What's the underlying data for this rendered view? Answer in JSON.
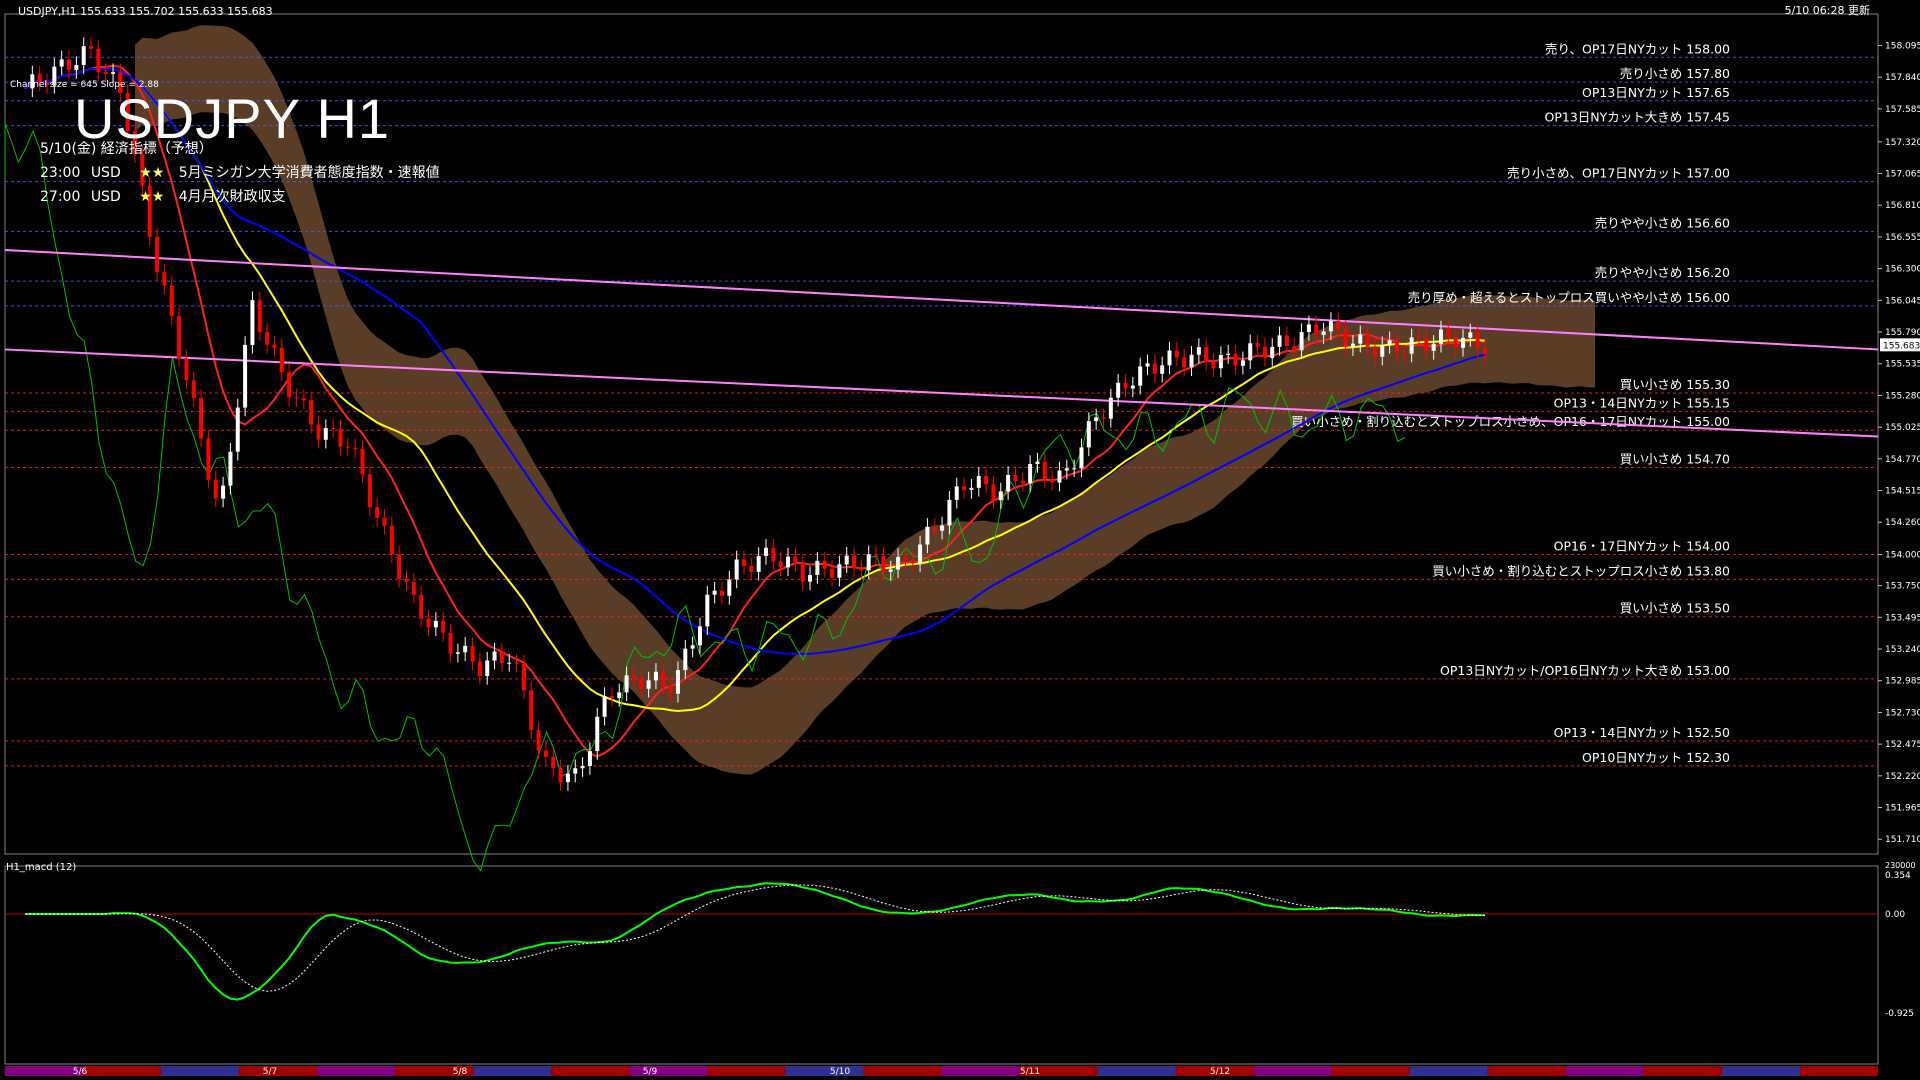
{
  "header": {
    "symbol_info": "USDJPY,H1  155.633 155.702 155.633 155.683",
    "updated": "5/10 06:28 更新"
  },
  "title": "USDJPY H1",
  "indicator_note": "Channel size = 645 Slope = 2.88",
  "events": [
    {
      "text": "5/10(金) 経済指標（予想）"
    },
    {
      "time": "23:00",
      "cur": "USD",
      "stars": "★★",
      "desc": "5月ミシガン大学消費者態度指数・速報値"
    },
    {
      "time": "27:00",
      "cur": "USD",
      "stars": "★★",
      "desc": "4月月次財政収支"
    }
  ],
  "macd": {
    "label": "H1_macd (12)",
    "ticks": [
      "0.354",
      "0.00",
      "-0.925"
    ],
    "scale_label": "230000"
  },
  "colors": {
    "bg": "#000000",
    "bull": "#ffffff",
    "bear": "#ff0000",
    "ma_yellow": "#ffff00",
    "ma_blue": "#0000ff",
    "channel": "#ff80ff",
    "cloud": "#ffb070",
    "chikou": "#00c000",
    "macd_line": "#00ff00",
    "macd_neg": "#ff8080"
  },
  "chart_data": {
    "type": "candlestick",
    "title": "USDJPY H1",
    "y_range": [
      151.72,
      158.3
    ],
    "y_ticks": [
      "158.095",
      "157.840",
      "157.585",
      "157.320",
      "157.065",
      "156.810",
      "156.555",
      "156.300",
      "156.045",
      "155.790",
      "155.535",
      "155.280",
      "155.025",
      "154.770",
      "154.515",
      "154.260",
      "154.000",
      "153.750",
      "153.495",
      "153.240",
      "152.985",
      "152.730",
      "152.475",
      "152.220",
      "151.965",
      "151.710"
    ],
    "current_price": "155.683",
    "x_labels": [
      "5/6",
      "5/7",
      "5/8",
      "5/9",
      "5/10",
      "5/11",
      "5/12"
    ],
    "levels": [
      {
        "label": "売り、OP17日NYカット 158.00",
        "price": 158.0,
        "color": "#4060ff"
      },
      {
        "label": "売り小さめ 157.80",
        "price": 157.8,
        "color": "#4060ff"
      },
      {
        "label": "OP13日NYカット 157.65",
        "price": 157.65,
        "color": "#4060ff"
      },
      {
        "label": "OP13日NYカット大きめ 157.45",
        "price": 157.45,
        "color": "#4060ff"
      },
      {
        "label": "売り小さめ、OP17日NYカット 157.00",
        "price": 157.0,
        "color": "#4060ff"
      },
      {
        "label": "売りやや小さめ 156.60",
        "price": 156.6,
        "color": "#4060ff"
      },
      {
        "label": "売りやや小さめ 156.20",
        "price": 156.2,
        "color": "#4060ff"
      },
      {
        "label": "売り厚め・超えるとストップロス買いやや小さめ 156.00",
        "price": 156.0,
        "color": "#4060ff"
      },
      {
        "label": "買い小さめ 155.30",
        "price": 155.3,
        "color": "#ff2020"
      },
      {
        "label": "OP13・14日NYカット 155.15",
        "price": 155.15,
        "color": "#ff2020"
      },
      {
        "label": "買い小さめ・割り込むとストップロス小さめ、OP16・17日NYカット 155.00",
        "price": 155.0,
        "color": "#ff2020"
      },
      {
        "label": "買い小さめ 154.70",
        "price": 154.7,
        "color": "#ff2020"
      },
      {
        "label": "OP16・17日NYカット 154.00",
        "price": 154.0,
        "color": "#ff2020"
      },
      {
        "label": "買い小さめ・割り込むとストップロス小さめ 153.80",
        "price": 153.8,
        "color": "#ff2020"
      },
      {
        "label": "買い小さめ 153.50",
        "price": 153.5,
        "color": "#ff2020"
      },
      {
        "label": "OP13日NYカット/OP16日NYカット大きめ 153.00",
        "price": 153.0,
        "color": "#ff2020"
      },
      {
        "label": "OP13・14日NYカット 152.50",
        "price": 152.5,
        "color": "#ff2020"
      },
      {
        "label": "OP10日NYカット 152.30",
        "price": 152.3,
        "color": "#ff2020"
      }
    ],
    "ohlc_path": [
      157.75,
      157.9,
      158.05,
      157.7,
      156.4,
      155.4,
      154.3,
      156.0,
      155.4,
      155.0,
      154.9,
      154.2,
      153.6,
      153.3,
      153.1,
      153.2,
      152.3,
      152.2,
      152.9,
      153.0,
      152.95,
      153.6,
      153.9,
      154.0,
      153.85,
      153.9,
      153.95,
      153.9,
      154.2,
      154.6,
      154.5,
      154.7,
      154.6,
      155.1,
      155.4,
      155.55,
      155.6,
      155.55,
      155.65,
      155.7,
      155.85,
      155.7,
      155.65,
      155.7,
      155.75,
      155.68
    ]
  }
}
